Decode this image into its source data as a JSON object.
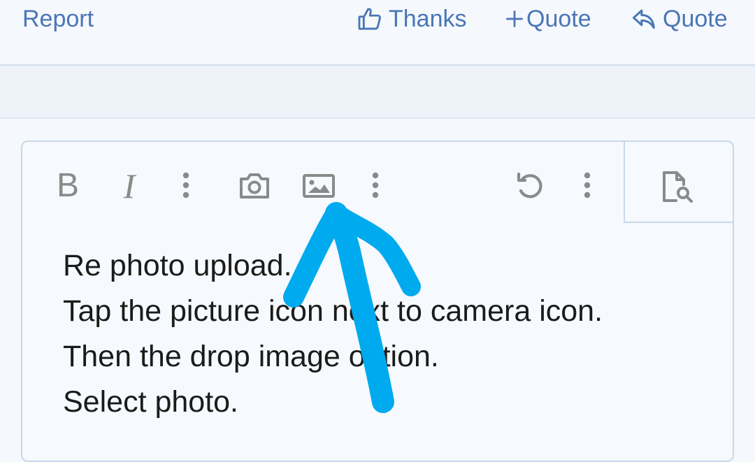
{
  "post_actions": {
    "report_label": "Report",
    "thanks_label": "Thanks",
    "multi_quote_label": "Quote",
    "quote_label": "Quote"
  },
  "toolbar": {
    "bold_label": "B",
    "italic_label": "I",
    "icons": {
      "more_text": "vertical-dots-icon",
      "camera": "camera-icon",
      "image": "image-icon",
      "more_insert": "vertical-dots-icon",
      "undo": "undo-icon",
      "more_options": "vertical-dots-icon",
      "preview": "document-search-icon"
    }
  },
  "editor": {
    "lines": [
      "Re photo upload.",
      "Tap the picture icon next to camera icon.",
      "Then the drop image option.",
      "Select photo."
    ]
  },
  "annotation": {
    "type": "hand-drawn-arrow",
    "color": "#00aaee"
  },
  "colors": {
    "link": "#4a76b6",
    "toolbar_icon": "#8a8a8a",
    "editor_border": "#c8d8ec",
    "background": "#f5f8fc",
    "band": "#eef2f9",
    "text": "#1b1b1b"
  }
}
